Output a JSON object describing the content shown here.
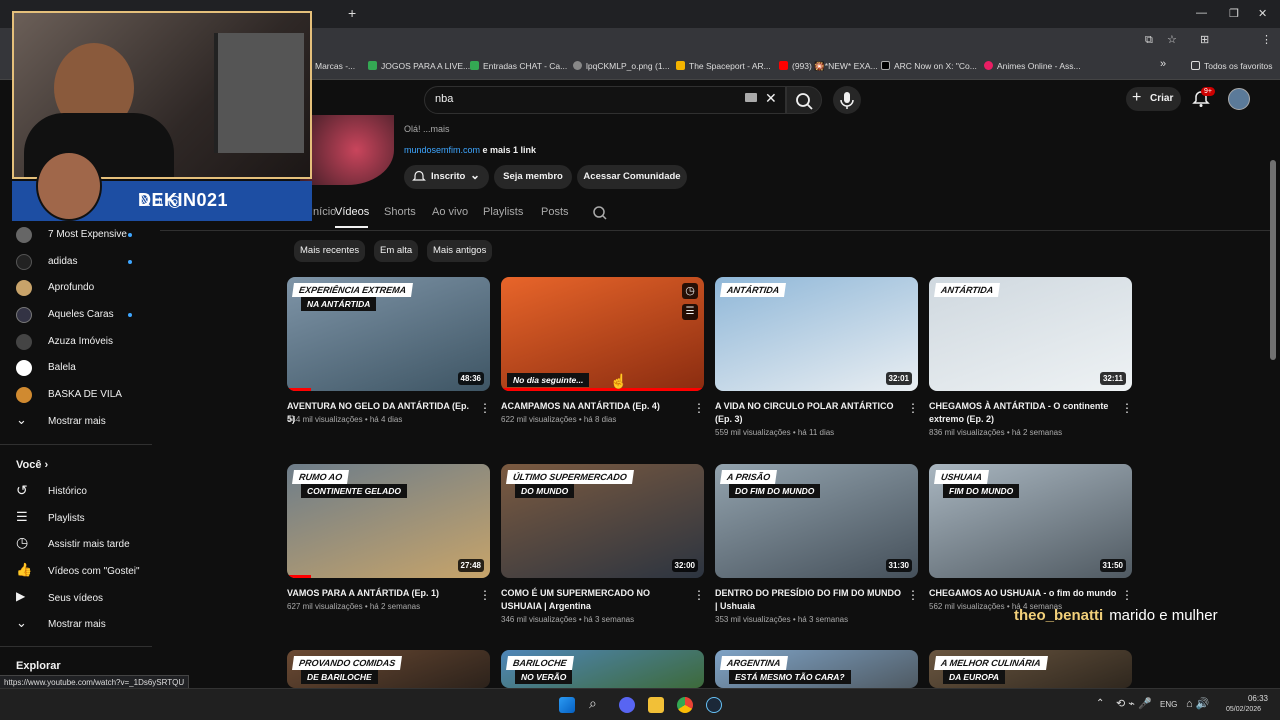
{
  "browser": {
    "url_partial": "",
    "bookmarks": [
      {
        "label": "Marcas -...",
        "color": "#555"
      },
      {
        "label": "JOGOS PARA A LIVE...",
        "color": "#34a853"
      },
      {
        "label": "Entradas CHAT - Ca...",
        "color": "#34a853"
      },
      {
        "label": "lpqCKMLP_o.png (1...",
        "color": "#888"
      },
      {
        "label": "The Spaceport - AR...",
        "color": "#f4b400"
      },
      {
        "label": "(993) 🎇*NEW* EXA...",
        "color": "#ff0000"
      },
      {
        "label": "ARC Now on X: \"Co...",
        "color": "#000000"
      },
      {
        "label": "Animes Online - Ass...",
        "color": "#e91e63"
      }
    ],
    "bookmarks_overflow": "»",
    "all_bookmarks": "Todos os favoritos",
    "new_tab": "+",
    "status_url": "https://www.youtube.com/watch?v=_1Ds6ySRTQU"
  },
  "header": {
    "search_value": "nba",
    "create_label": "Criar",
    "notif_badge": "9+"
  },
  "channel": {
    "about": "Olá! ...mais",
    "link": "mundosemfim.com",
    "link_suffix": " e mais 1 link",
    "subscribed_label": "Inscrito",
    "member_label": "Seja membro",
    "community_label": "Acessar Comunidade",
    "tabs": [
      {
        "label": "Início"
      },
      {
        "label": "Vídeos"
      },
      {
        "label": "Shorts"
      },
      {
        "label": "Ao vivo"
      },
      {
        "label": "Playlists"
      },
      {
        "label": "Posts"
      }
    ],
    "filters": [
      "Mais recentes",
      "Em alta",
      "Mais antigos"
    ]
  },
  "sidebar": {
    "subs": [
      {
        "label": "7 Most Expensive",
        "dot": true,
        "color": "#666"
      },
      {
        "label": "adidas",
        "dot": true,
        "color": "#222"
      },
      {
        "label": "Aprofundo",
        "dot": false,
        "color": "#c8a36a"
      },
      {
        "label": "Aqueles Caras",
        "dot": true,
        "color": "#334"
      },
      {
        "label": "Azuza Imóveis",
        "dot": false,
        "color": "#444"
      },
      {
        "label": "Balela",
        "dot": false,
        "color": "#fff"
      },
      {
        "label": "BASKA DE VILA",
        "dot": false,
        "color": "#d08a30"
      }
    ],
    "show_more": "Mostrar mais",
    "you_title": "Você",
    "you_items": [
      {
        "label": "Histórico",
        "icon": "history-icon"
      },
      {
        "label": "Playlists",
        "icon": "playlist-icon"
      },
      {
        "label": "Assistir mais tarde",
        "icon": "clock-icon"
      },
      {
        "label": "Vídeos com \"Gostei\"",
        "icon": "thumbs-up-icon"
      },
      {
        "label": "Seus vídeos",
        "icon": "video-icon"
      }
    ],
    "show_more_2": "Mostrar mais",
    "explore_title": "Explorar"
  },
  "videos": [
    {
      "title": "AVENTURA NO GELO DA ANTÁRTIDA (Ep. 5)",
      "views": "444 mil visualizações",
      "age": "há 4 dias",
      "duration": "48:36",
      "tag": "EXPERIÊNCIA EXTREMA",
      "tag2": "NA ANTÁRTIDA",
      "bg1": "#7f95a8",
      "bg2": "#3e5564"
    },
    {
      "title": "ACAMPAMOS NA ANTÁRTIDA (Ep. 4)",
      "views": "622 mil visualizações",
      "age": "há 8 dias",
      "duration": "",
      "tag": "",
      "tag2": "No dia seguinte...",
      "bg1": "#e8652a",
      "bg2": "#8a2c10"
    },
    {
      "title": "A VIDA NO CIRCULO POLAR ANTÁRTICO (Ep. 3)",
      "views": "559 mil visualizações",
      "age": "há 11 dias",
      "duration": "32:01",
      "tag": "ANTÁRTIDA",
      "tag2": "",
      "bg1": "#8fb7d8",
      "bg2": "#e9eef2"
    },
    {
      "title": "CHEGAMOS À ANTÁRTIDA - O continente extremo (Ep. 2)",
      "views": "836 mil visualizações",
      "age": "há 2 semanas",
      "duration": "32:11",
      "tag": "ANTÁRTIDA",
      "tag2": "",
      "bg1": "#cfd8df",
      "bg2": "#eef2f4"
    },
    {
      "title": "VAMOS PARA A ANTÁRTIDA (Ep. 1)",
      "views": "627 mil visualizações",
      "age": "há 2 semanas",
      "duration": "27:48",
      "tag": "RUMO AO",
      "tag2": "CONTINENTE GELADO",
      "bg1": "#6d7d8a",
      "bg2": "#c7a46a"
    },
    {
      "title": "COMO É UM SUPERMERCADO NO USHUAIA | Argentina",
      "views": "346 mil visualizações",
      "age": "há 3 semanas",
      "duration": "32:00",
      "tag": "ÚLTIMO SUPERMERCADO",
      "tag2": "DO MUNDO",
      "bg1": "#7b5a40",
      "bg2": "#2c3440"
    },
    {
      "title": "DENTRO DO PRESÍDIO DO FIM DO MUNDO | Ushuaia",
      "views": "353 mil visualizações",
      "age": "há 3 semanas",
      "duration": "31:30",
      "tag": "A PRISÃO",
      "tag2": "DO FIM DO MUNDO",
      "bg1": "#93a3ae",
      "bg2": "#45505a"
    },
    {
      "title": "CHEGAMOS AO USHUAIA - o fim do mundo",
      "views": "562 mil visualizações",
      "age": "há 4 semanas",
      "duration": "31:50",
      "tag": "USHUAIA",
      "tag2": "FIM DO MUNDO",
      "bg1": "#a9b6c0",
      "bg2": "#505a62"
    },
    {
      "title": "",
      "views": "",
      "age": "",
      "duration": "",
      "tag": "PROVANDO COMIDAS",
      "tag2": "DE BARILOCHE",
      "bg1": "#6b4a33",
      "bg2": "#2c221b"
    },
    {
      "title": "",
      "views": "",
      "age": "",
      "duration": "",
      "tag": "BARILOCHE",
      "tag2": "NO VERÃO",
      "bg1": "#4f86b8",
      "bg2": "#3d6a3a"
    },
    {
      "title": "",
      "views": "",
      "age": "",
      "duration": "",
      "tag": "ARGENTINA",
      "tag2": "ESTÁ MESMO TÃO CARA?",
      "bg1": "#7fa3c6",
      "bg2": "#4f5a63"
    },
    {
      "title": "",
      "views": "",
      "age": "",
      "duration": "",
      "tag": "A MELHOR CULINÁRIA",
      "tag2": "DA EUROPA",
      "bg1": "#6a5640",
      "bg2": "#2f271e"
    }
  ],
  "overlay": {
    "handle": "DEKIN021",
    "chat_user": "theo_benatti",
    "chat_msg": "marido e mulher"
  },
  "taskbar": {
    "lang": "ENG",
    "time": "06:33",
    "date": "05/02/2026"
  }
}
